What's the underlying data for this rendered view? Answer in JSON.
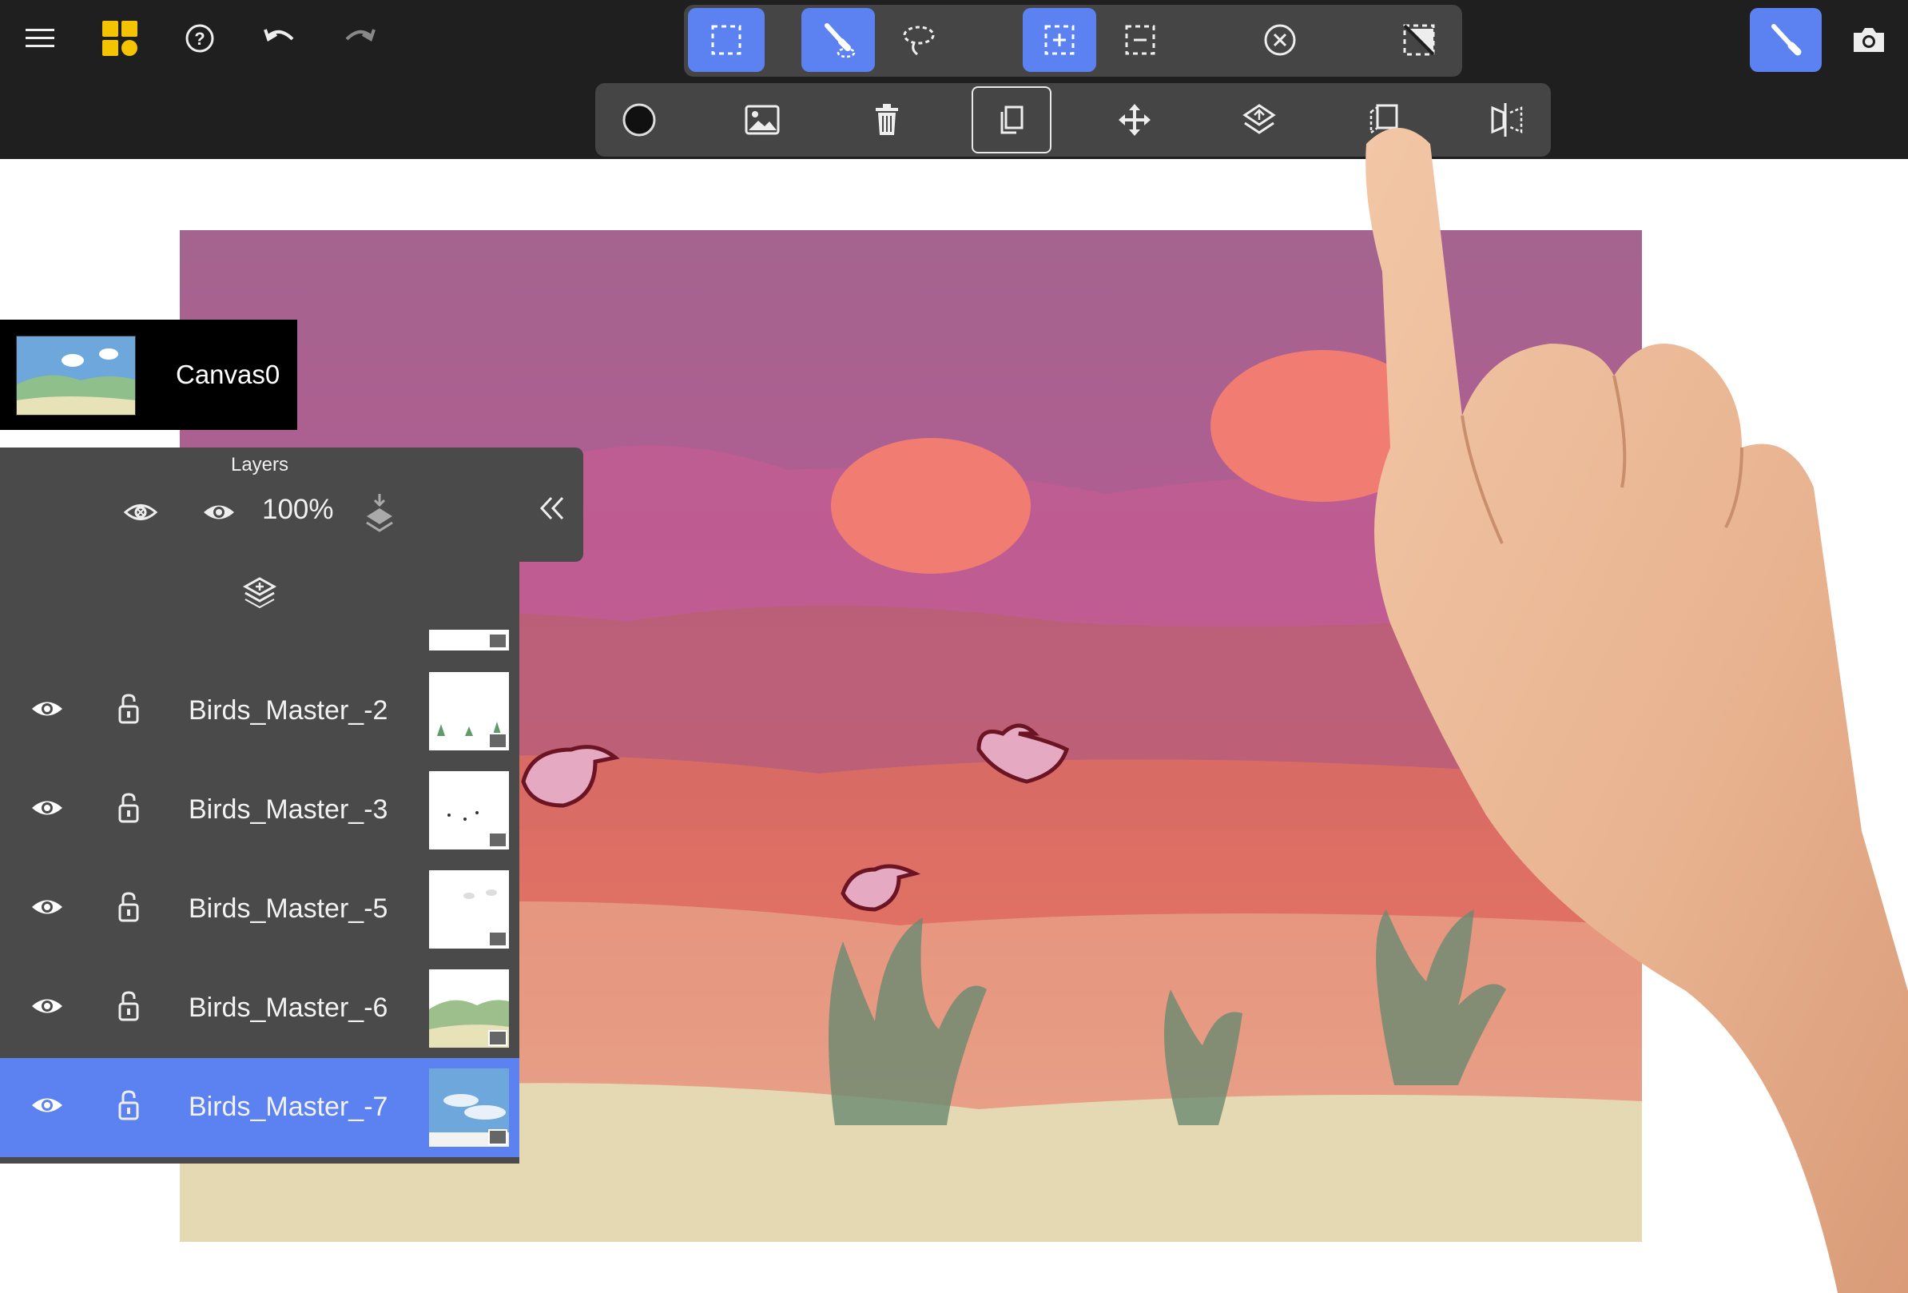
{
  "canvas": {
    "name": "Canvas0"
  },
  "layers_panel": {
    "title": "Layers",
    "opacity": "100%",
    "layers": [
      {
        "name": "Birds_Master_-2",
        "visible": true,
        "locked": false,
        "active": false
      },
      {
        "name": "Birds_Master_-3",
        "visible": true,
        "locked": false,
        "active": false
      },
      {
        "name": "Birds_Master_-5",
        "visible": true,
        "locked": false,
        "active": false
      },
      {
        "name": "Birds_Master_-6",
        "visible": true,
        "locked": false,
        "active": false
      },
      {
        "name": "Birds_Master_-7",
        "visible": true,
        "locked": false,
        "active": true
      }
    ]
  },
  "toolbar": {
    "left_icons": [
      "menu-icon",
      "gallery-grid-icon",
      "help-icon",
      "undo-icon",
      "redo-icon"
    ],
    "selection_tools": [
      "rect-select-icon",
      "brush-select-icon",
      "lasso-select-icon",
      "select-add-icon",
      "select-subtract-icon",
      "deselect-icon",
      "invert-selection-icon"
    ],
    "selection_actions": [
      "circle-fill-icon",
      "image-icon",
      "delete-icon",
      "copy-icon",
      "move-icon",
      "layer-icon",
      "flip-icon",
      "mirror-icon"
    ],
    "right_icons": [
      "brush-mode-icon",
      "camera-icon"
    ]
  },
  "colors": {
    "accent": "#5b82f0",
    "toolbar_bg": "#1f1f1f",
    "panel_bg": "#4a4a4a",
    "logo_yellow": "#f5c400"
  }
}
